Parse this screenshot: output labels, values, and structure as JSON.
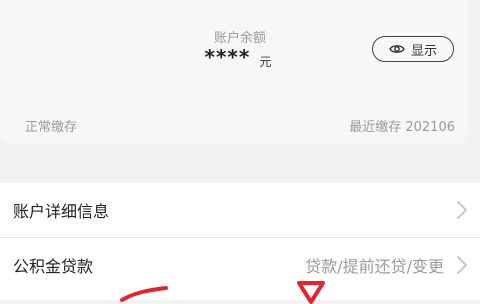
{
  "balance": {
    "label": "账户余额",
    "value": "****",
    "unit": "元",
    "show_button_label": "显示",
    "status_left": "正常缴存",
    "status_right": "最近缴存 202106"
  },
  "list": [
    {
      "label": "账户详细信息",
      "right_text": "",
      "icon": "chevron-right-icon"
    },
    {
      "label": "公积金贷款",
      "right_text": "贷款/提前还贷/变更",
      "icon": "chevron-right-icon"
    }
  ],
  "colors": {
    "background": "#f2f2f2",
    "card": "#f7f7f7",
    "muted_text": "#9a9a9a",
    "primary_text": "#222222",
    "annotation_red": "#e0262c"
  }
}
